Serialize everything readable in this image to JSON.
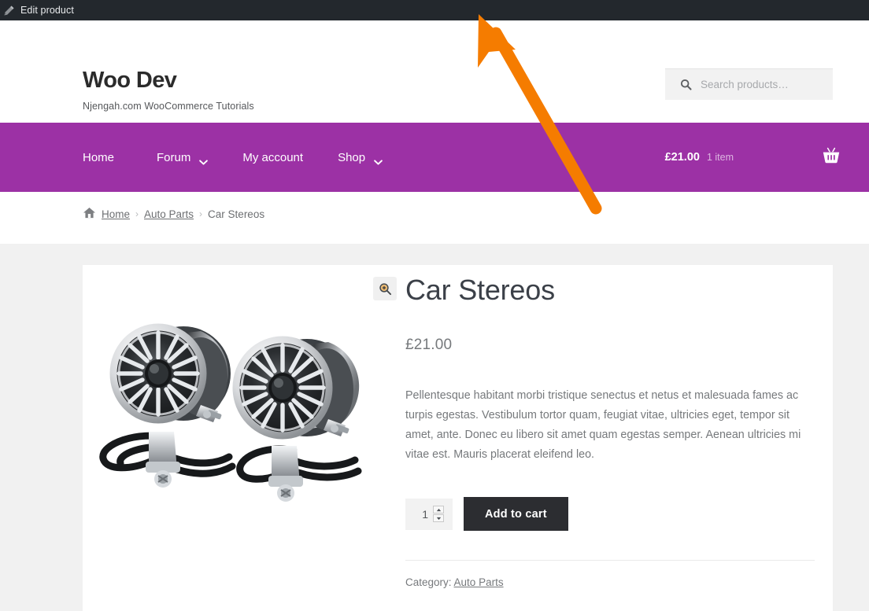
{
  "admin_bar": {
    "edit_label": "Edit product",
    "icon": "pencil-icon",
    "background": "#23282d"
  },
  "header": {
    "site_title": "Woo Dev",
    "tagline": "Njengah.com WooCommerce Tutorials",
    "search": {
      "placeholder": "Search products…",
      "value": "",
      "icon": "search-icon"
    }
  },
  "nav": {
    "background": "#9c31a5",
    "items": [
      {
        "label": "Home",
        "has_dropdown": false
      },
      {
        "label": "Forum",
        "has_dropdown": true
      },
      {
        "label": "My account",
        "has_dropdown": false
      },
      {
        "label": "Shop",
        "has_dropdown": true
      }
    ],
    "cart": {
      "amount": "£21.00",
      "count": "1 item",
      "icon": "shopping-basket-icon"
    }
  },
  "breadcrumb": {
    "home_icon": "home-icon",
    "items": [
      {
        "label": "Home",
        "link": true
      },
      {
        "label": "Auto Parts",
        "link": true
      },
      {
        "label": "Car Stereos",
        "link": false
      }
    ],
    "separator": "›"
  },
  "product": {
    "title": "Car Stereos",
    "price": "£21.00",
    "description": "Pellentesque habitant morbi tristique senectus et netus et malesuada fames ac turpis egestas. Vestibulum tortor quam, feugiat vitae, ultricies eget, tempor sit amet, ante. Donec eu libero sit amet quam egestas semper. Aenean ultricies mi vitae est. Mauris placerat eleifend leo.",
    "quantity": "1",
    "add_to_cart_label": "Add to cart",
    "meta_label": "Category:",
    "category": "Auto Parts",
    "gallery": {
      "zoom_icon": "magnifier-plus-icon",
      "image_alt": "Pair of chrome car stereo speakers with mounting brackets and black cables"
    }
  },
  "annotation": {
    "arrow_color": "#f57c00",
    "type": "arrow"
  },
  "colors": {
    "page_background": "#f1f1f1",
    "card_background": "#ffffff",
    "accent_purple": "#9c31a5",
    "button_dark": "#2c2d31",
    "text_muted": "#76797c"
  }
}
